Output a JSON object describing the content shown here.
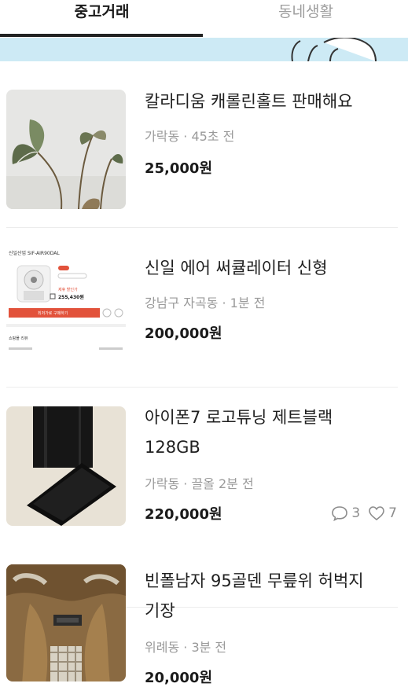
{
  "tabs": [
    {
      "label": "중고거래",
      "active": true
    },
    {
      "label": "동네생활",
      "active": false
    }
  ],
  "colors": {
    "banner": "#cdeaf5",
    "meta": "#9a9a9a",
    "accent_red": "#e2523b"
  },
  "items": [
    {
      "title_line1": "칼라디움 캐롤린홀트 판매해요",
      "title_line2": "",
      "location": "가락동",
      "time": "45초 전",
      "price": "25,000원",
      "image_icon": "plant-photo"
    },
    {
      "title_line1": "신일 에어 써큘레이터 신형",
      "title_line2": "",
      "location": "강남구 자곡동",
      "time": "1분 전",
      "price": "200,000원",
      "image_icon": "product-screenshot",
      "image_text": {
        "brand": "신일산업 SIF-AIR90DAL",
        "discount_label": "제휴 할인가",
        "price": "255,430원",
        "button": "최저가로 구매하기",
        "section": "쇼핑몰 리뷰"
      }
    },
    {
      "title_line1": "아이폰7 로고튜닝 제트블랙",
      "title_line2": "128GB",
      "location": "가락동",
      "time": "끌올 2분 전",
      "price": "220,000원",
      "image_icon": "phone-photo",
      "chats": "3",
      "likes": "7"
    },
    {
      "title_line1": "빈폴남자 95골덴 무릎위 허벅지",
      "title_line2": "기장",
      "location": "위례동",
      "time": "3분 전",
      "price": "20,000원",
      "image_icon": "jacket-photo"
    }
  ]
}
